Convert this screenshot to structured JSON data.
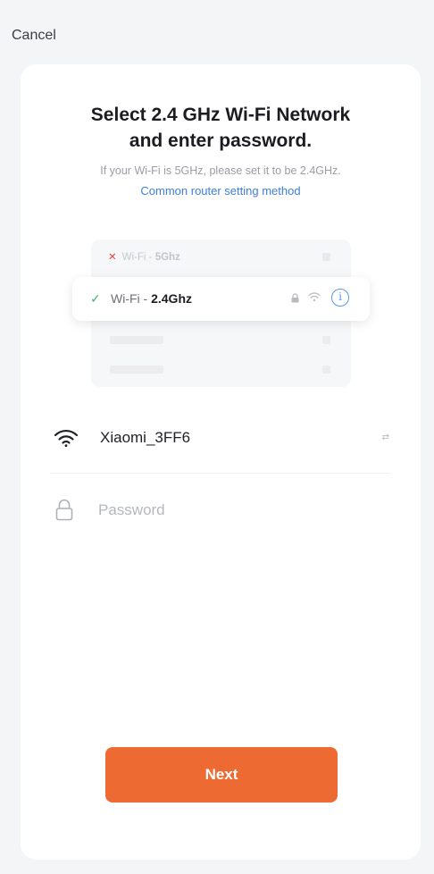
{
  "header": {
    "cancel_label": "Cancel"
  },
  "card": {
    "title_line1": "Select 2.4 GHz Wi-Fi Network",
    "title_line2": "and enter password.",
    "subtitle": "If your Wi-Fi is 5GHz, please set it to be 2.4GHz.",
    "link": "Common router setting method"
  },
  "illustration": {
    "row_5g": {
      "prefix": "Wi-Fi - ",
      "band": "5Ghz",
      "status": "unsupported"
    },
    "row_24g": {
      "prefix": "Wi-Fi - ",
      "band": "2.4Ghz",
      "status": "supported"
    },
    "icons": [
      "lock-icon",
      "wifi-icon",
      "info-icon"
    ]
  },
  "form": {
    "ssid": "Xiaomi_3FF6",
    "switch_label": "⇄",
    "password_value": "",
    "password_placeholder": "Password"
  },
  "actions": {
    "next_label": "Next"
  },
  "colors": {
    "accent": "#ee6a33",
    "link": "#3d7fd6",
    "check": "#46b36a",
    "cross": "#e3483b"
  }
}
